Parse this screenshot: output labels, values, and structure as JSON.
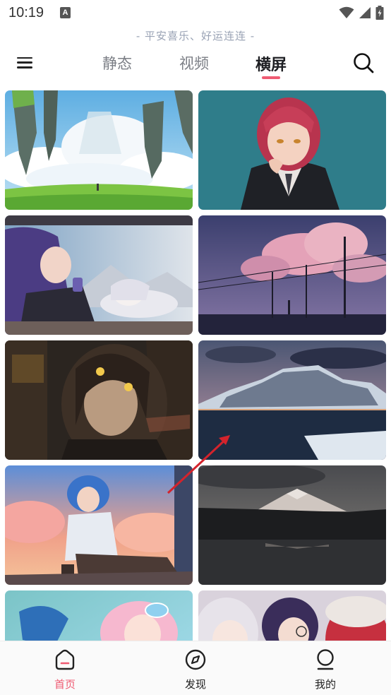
{
  "status_bar": {
    "time": "10:19",
    "app_icon_letter": "A"
  },
  "header": {
    "slogan": "- 平安喜乐、好运连连 -",
    "tabs": [
      {
        "label": "静态",
        "active": false
      },
      {
        "label": "视频",
        "active": false
      },
      {
        "label": "横屏",
        "active": true
      }
    ]
  },
  "colors": {
    "accent": "#ef5b72",
    "slogan": "#9aa3b5",
    "tab_inactive": "#7c7f86"
  },
  "wallpapers": [
    {
      "subject": "sky-islands-clouds"
    },
    {
      "subject": "red-haired-girl-portrait"
    },
    {
      "subject": "purple-haired-girls-resting"
    },
    {
      "subject": "pink-clouds-power-lines"
    },
    {
      "subject": "dark-haired-girl-glowing-eyes"
    },
    {
      "subject": "snowy-mountain-lake-dusk"
    },
    {
      "subject": "blue-haired-girl-sunset"
    },
    {
      "subject": "dark-mountain-lake"
    },
    {
      "subject": "pink-haired-girl-pool"
    },
    {
      "subject": "anime-friends-group"
    }
  ],
  "bottom_nav": [
    {
      "label": "首页",
      "icon": "home-icon",
      "active": true
    },
    {
      "label": "发现",
      "icon": "compass-icon",
      "active": false
    },
    {
      "label": "我的",
      "icon": "profile-icon",
      "active": false
    }
  ]
}
